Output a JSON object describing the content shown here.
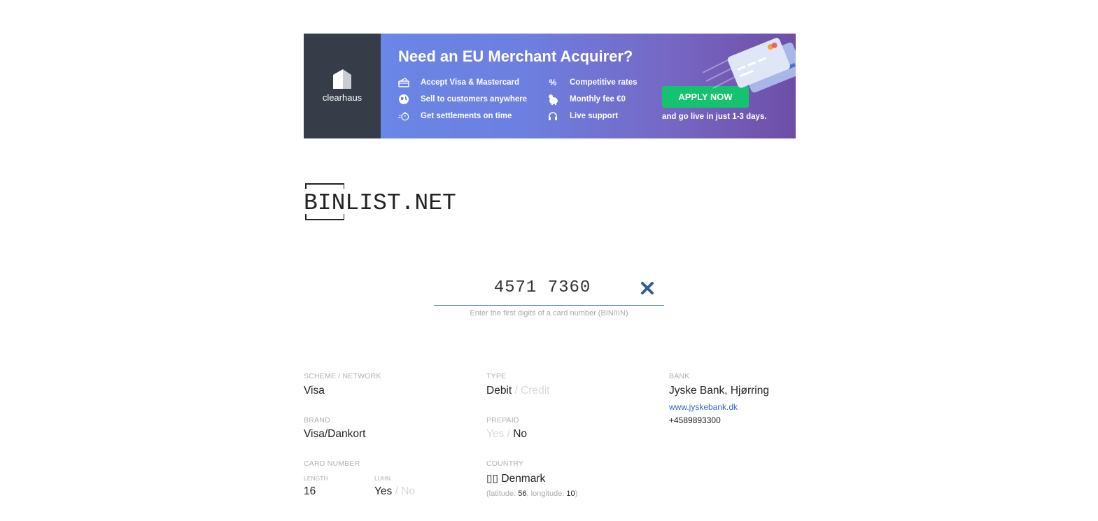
{
  "banner": {
    "brand": "clearhaus",
    "title": "Need an EU Merchant Acquirer?",
    "features_left": [
      {
        "icon": "card-stack-icon",
        "label": "Accept Visa & Mastercard"
      },
      {
        "icon": "globe-icon",
        "label": "Sell to customers anywhere"
      },
      {
        "icon": "stopwatch-icon",
        "label": "Get settlements on time"
      }
    ],
    "features_right": [
      {
        "icon": "percent-icon",
        "glyph": "%",
        "label": "Competitive rates"
      },
      {
        "icon": "piggy-bank-icon",
        "label": "Monthly fee €0"
      },
      {
        "icon": "headset-icon",
        "label": "Live support"
      }
    ],
    "cta": "APPLY NOW",
    "cta_note": "and go live in just 1-3 days.",
    "colors": {
      "left_panel": "#363d49",
      "button": "#15c26f"
    }
  },
  "site": {
    "logo_text": "BINLIST.NET"
  },
  "search": {
    "value": "4571 7360",
    "hint": "Enter the first digits of a card number (BIN/IIN)"
  },
  "results": {
    "scheme": {
      "label": "Scheme / network",
      "value": "Visa"
    },
    "type": {
      "label": "Type",
      "active": "Debit",
      "separator": " / ",
      "inactive": "Credit"
    },
    "bank": {
      "label": "Bank",
      "name": "Jyske Bank, Hjørring",
      "url": "www.jyskebank.dk",
      "phone": "+4589893300"
    },
    "brand": {
      "label": "Brand",
      "value": "Visa/Dankort"
    },
    "prepaid": {
      "label": "Prepaid",
      "inactive": "Yes",
      "separator": " / ",
      "active": "No"
    },
    "card_number": {
      "label": "Card number",
      "length_label": "Length",
      "length": "16",
      "luhn_label": "Luhn",
      "luhn_active": "Yes",
      "luhn_separator": " / ",
      "luhn_inactive": "No"
    },
    "country": {
      "label": "Country",
      "flag": "▯▯",
      "name": "Denmark",
      "open": "(",
      "lat_label": "latitude: ",
      "lat": "56",
      "sep": ", ",
      "lon_label": "longitude: ",
      "lon": "10",
      "close": ")"
    }
  }
}
